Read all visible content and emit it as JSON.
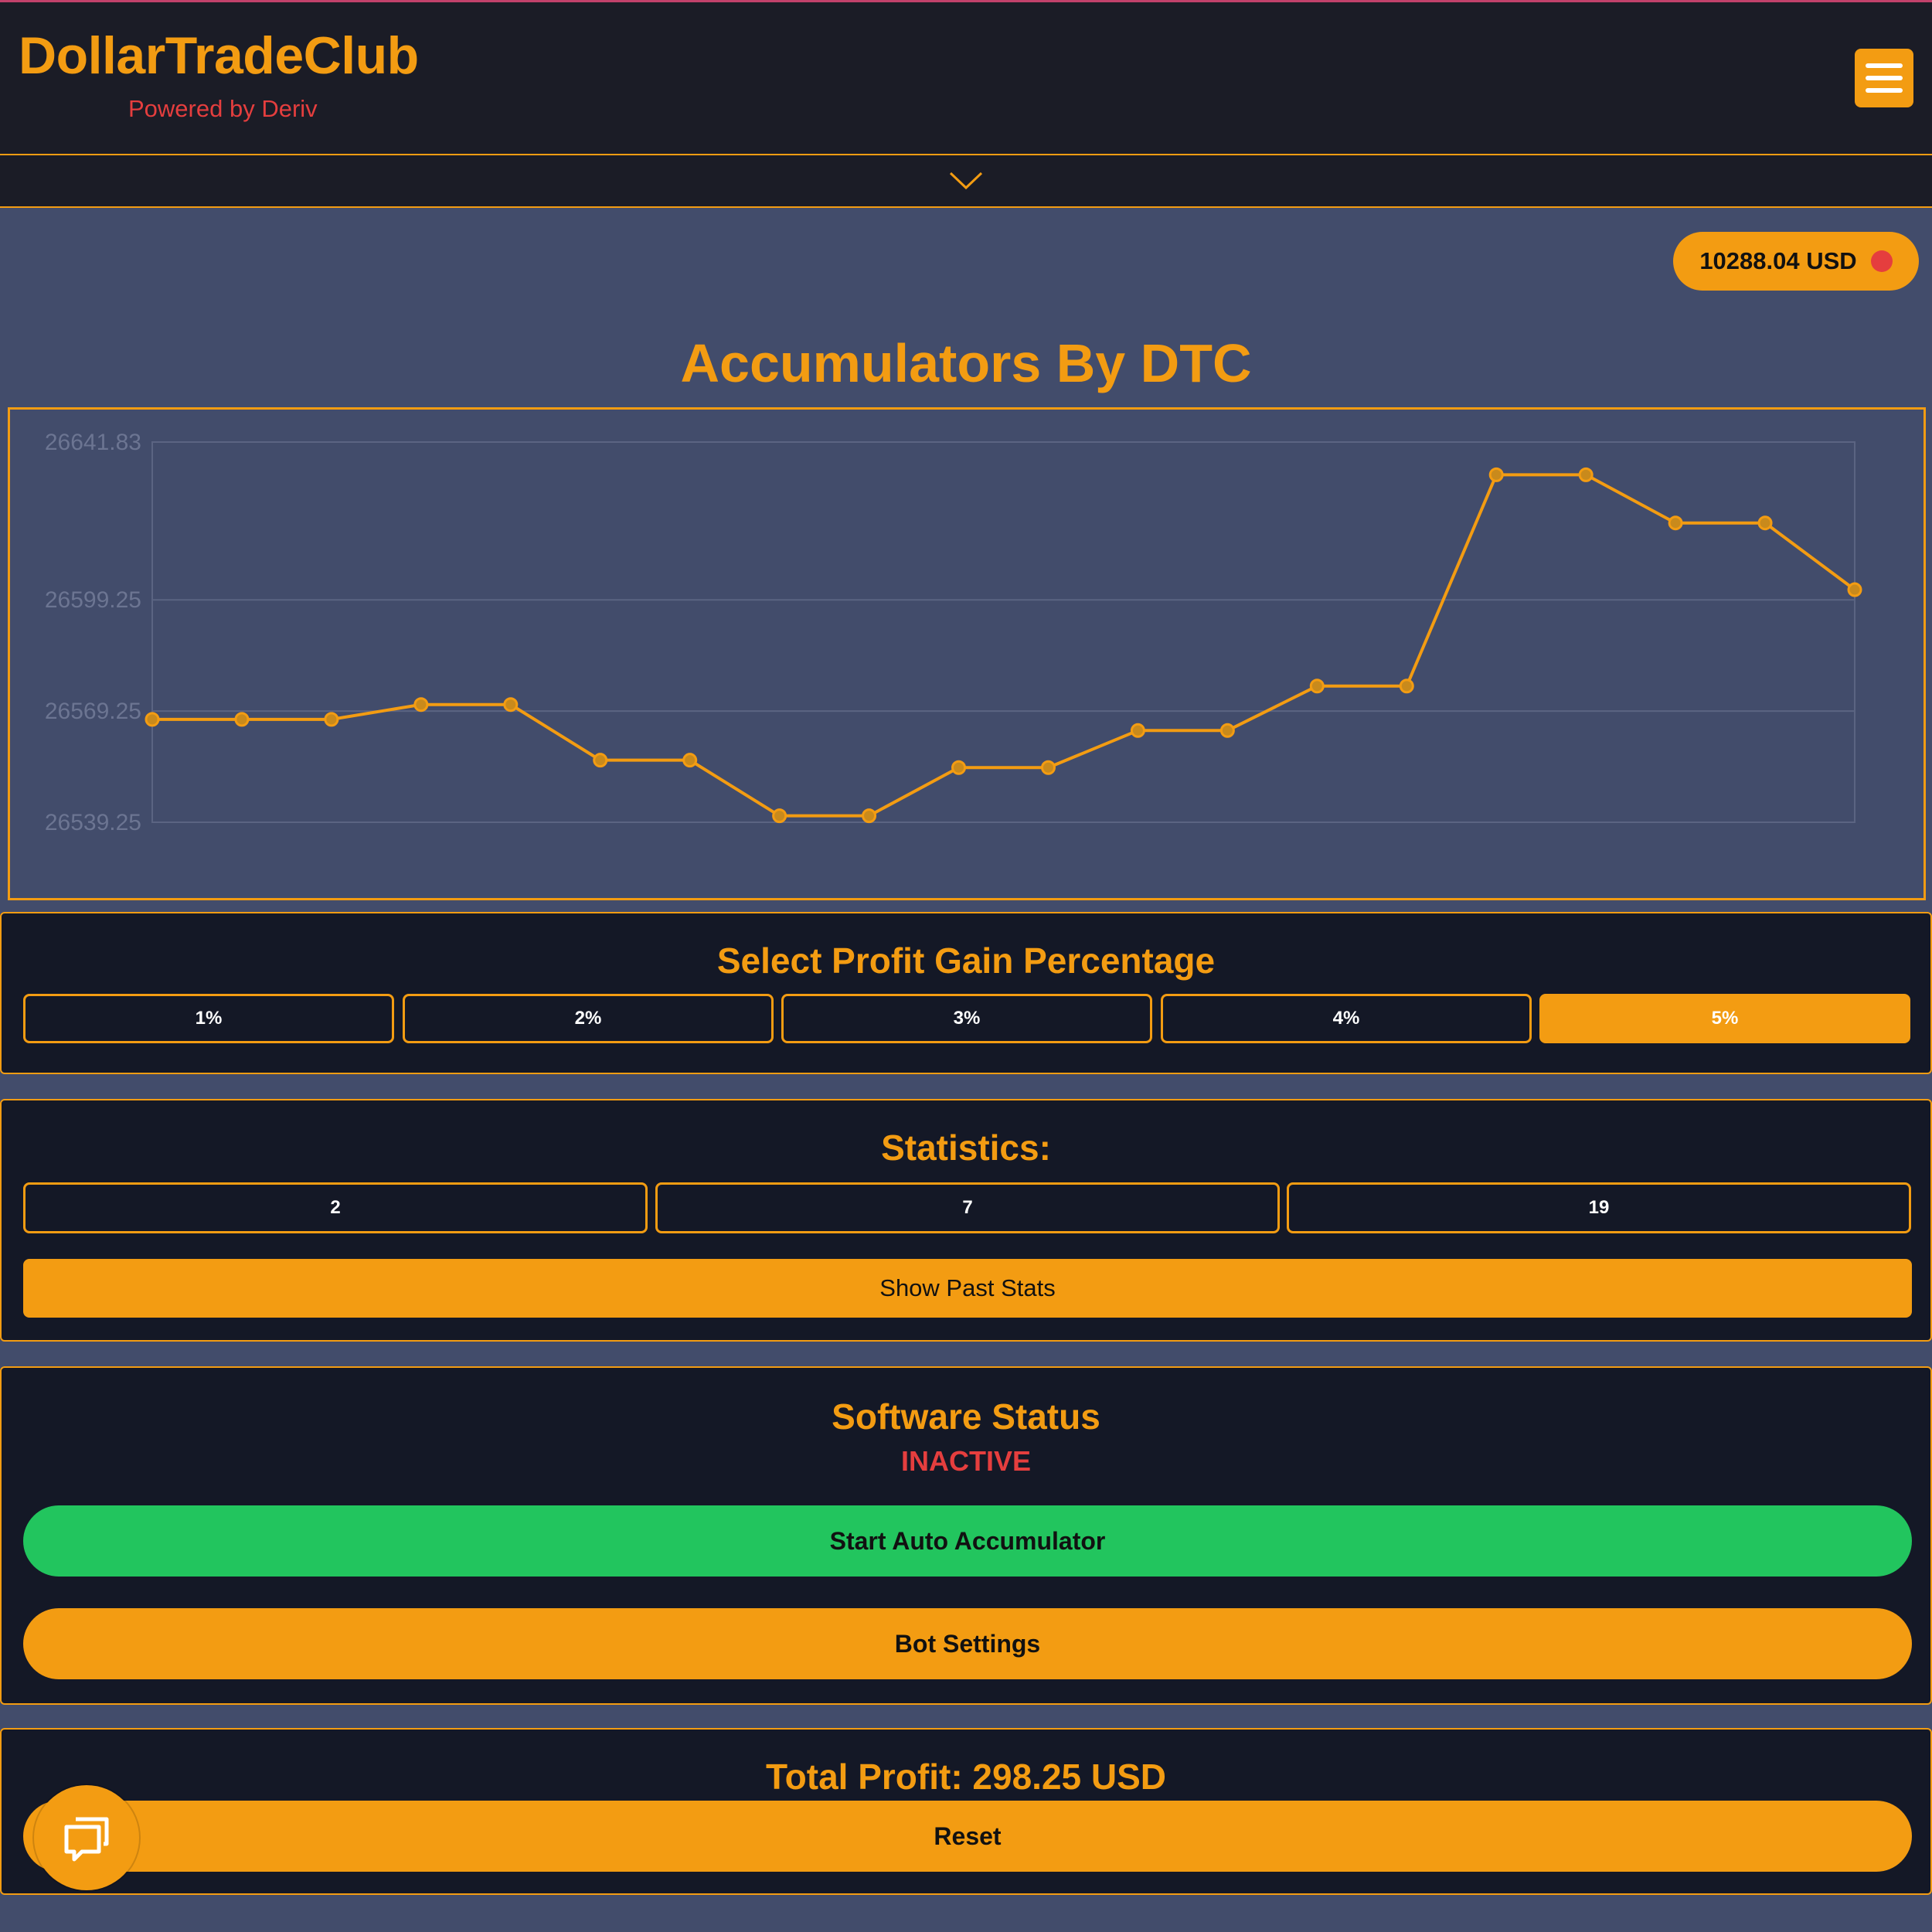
{
  "header": {
    "brand": "DollarTradeClub",
    "tagline": "Powered by Deriv",
    "menu_icon": "hamburger-icon"
  },
  "collapse_icon": "chevron-down-icon",
  "balance": {
    "label": "10288.04 USD",
    "status_color": "#e53e3e"
  },
  "title": "Accumulators By DTC",
  "chart_data": {
    "type": "line",
    "title": "",
    "xlabel": "",
    "ylabel": "",
    "y_tick_labels": [
      "26641.83",
      "26599.25",
      "26569.25",
      "26539.25"
    ],
    "ylim": [
      26539.25,
      26641.83
    ],
    "x_ticks_shown": false,
    "grid": true,
    "series": [
      {
        "values": [
          26567,
          26567,
          26567,
          26571,
          26571,
          26556,
          26556,
          26541,
          26541,
          26554,
          26554,
          26564,
          26564,
          26576,
          26576,
          26633,
          26633,
          26620,
          26620,
          26602
        ]
      }
    ],
    "line_color": "#f39c12"
  },
  "profit": {
    "title": "Select Profit Gain Percentage",
    "options": [
      "1%",
      "2%",
      "3%",
      "4%",
      "5%"
    ],
    "selected": "5%"
  },
  "statistics": {
    "title": "Statistics:",
    "values": [
      "2",
      "7",
      "19"
    ],
    "show_past_label": "Show Past Stats"
  },
  "software": {
    "title": "Software Status",
    "status": "INACTIVE",
    "start_label": "Start Auto Accumulator",
    "settings_label": "Bot Settings"
  },
  "total": {
    "title": "Total Profit: 298.25 USD",
    "reset_label": "Reset"
  },
  "chat_icon": "chat-bubble-icon",
  "colors": {
    "accent": "#f39c12",
    "panel": "#141826",
    "page": "#424c6b",
    "green": "#22c55e",
    "danger": "#e53e3e"
  }
}
